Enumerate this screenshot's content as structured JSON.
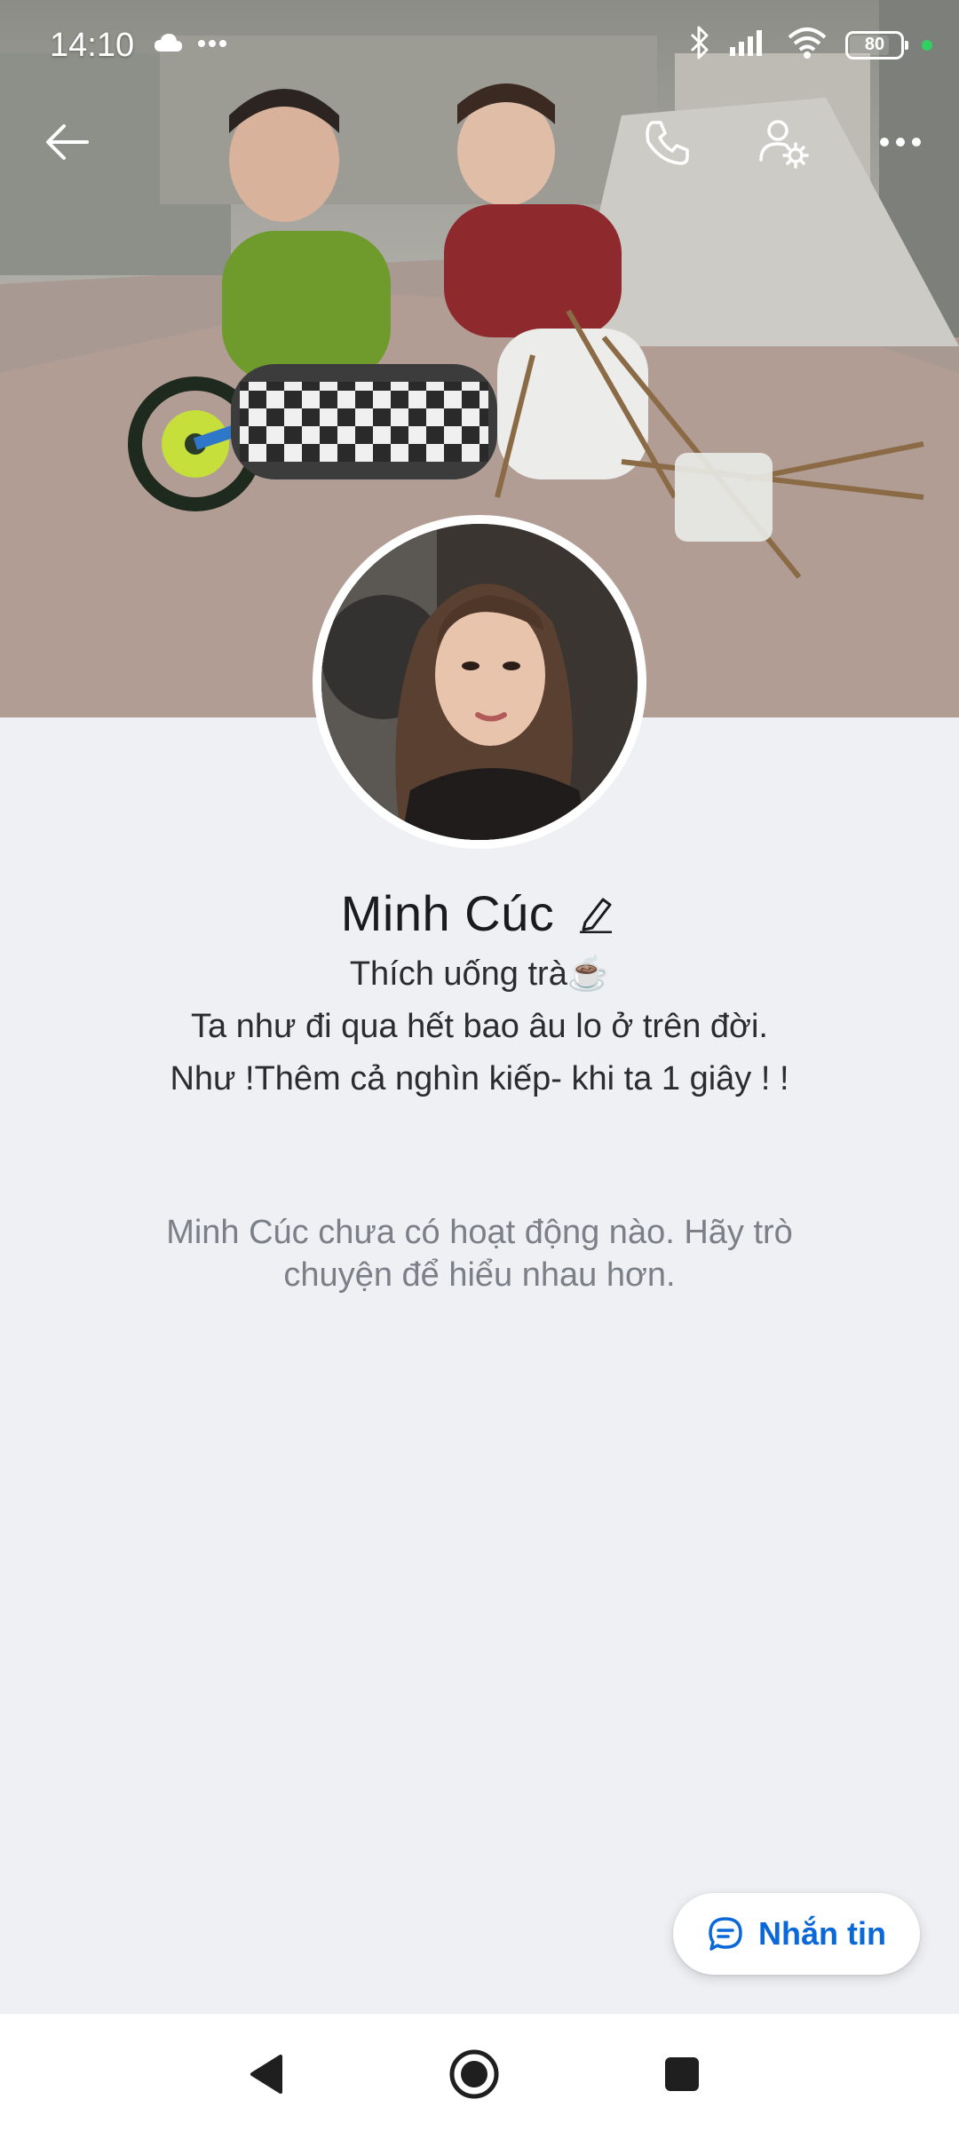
{
  "status_bar": {
    "time": "14:10",
    "battery": "80",
    "battery_level": 0.8,
    "left_icons": [
      "cloud-icon",
      "more-dots-icon"
    ],
    "right_icons": [
      "bluetooth-icon",
      "signal-icon",
      "wifi-icon",
      "battery-icon",
      "active-dot-icon"
    ]
  },
  "top_nav": {
    "icons": [
      "back-arrow-icon",
      "phone-icon",
      "user-settings-icon",
      "more-horizontal-icon"
    ]
  },
  "profile": {
    "name": "Minh Cúc",
    "bio_lines": [
      "Thích uống trà☕",
      "Ta như đi qua hết bao âu lo ở trên đời.",
      "Như !Thêm cả nghìn kiếp- khi ta 1 giây ! !"
    ],
    "empty_activity": "Minh Cúc chưa có hoạt động nào. Hãy trò chuyện để hiểu nhau hơn."
  },
  "message_button": {
    "label": "Nhắn tin",
    "icon": "chat-bubble-icon"
  },
  "system_nav": {
    "icons": [
      "nav-back-icon",
      "nav-home-icon",
      "nav-recents-icon"
    ]
  },
  "colors": {
    "accent": "#0b68d8",
    "background": "#eff0f4",
    "status_green": "#2fd160"
  }
}
